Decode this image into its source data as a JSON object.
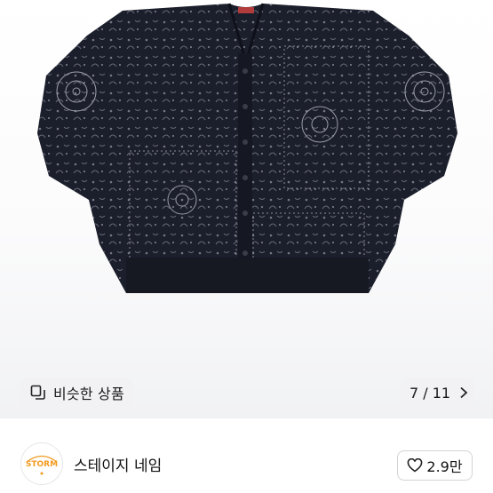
{
  "product": {
    "image_icon": "bandana-paisley-cardigan-photo"
  },
  "similar_button": {
    "label": "비슷한 상품",
    "icon": "similar-items-icon"
  },
  "pager": {
    "current": "7",
    "total": "11",
    "text": "7 / 11",
    "icon": "chevron-right-icon"
  },
  "shop": {
    "name": "스테이지 네임",
    "avatar_text": "STORM",
    "avatar_color": "#f29a1f"
  },
  "like": {
    "count": "2.9만",
    "icon": "heart-outline-icon"
  },
  "colors": {
    "chip_bg": "#f2f2f4",
    "border": "#d4d4d8",
    "garment": "#1b1e2b",
    "pattern": "#8b8e99"
  }
}
